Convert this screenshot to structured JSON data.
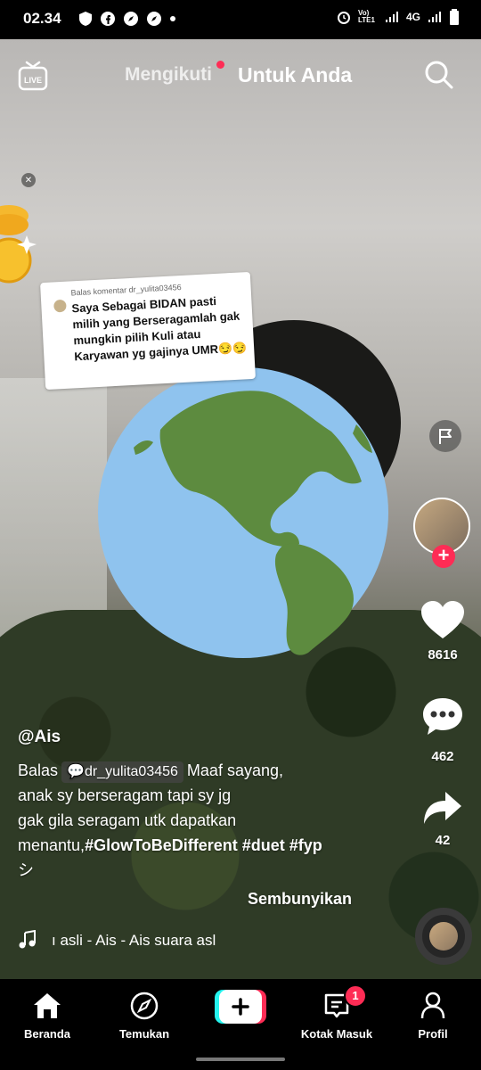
{
  "status_bar": {
    "time": "02.34",
    "network": "4G",
    "volte": "Vo) LTE1"
  },
  "top_nav": {
    "live_label": "LIVE",
    "tab_following": "Mengikuti",
    "tab_for_you": "Untuk Anda"
  },
  "reply_card": {
    "header": "Balas komentar dr_yulita03456",
    "text": "Saya Sebagai BIDAN pasti milih yang Berseragamlah gak mungkin pilih Kuli atau Karyawan yg gajinya UMR😏😏"
  },
  "actions": {
    "likes": "8616",
    "comments": "462",
    "shares": "42"
  },
  "caption": {
    "username": "@Ais",
    "reply_prefix": "Balas",
    "reply_user": "dr_yulita03456",
    "text_part1": "Maaf sayang,",
    "text_part2": "anak sy berseragam tapi sy  jg",
    "text_part3": "gak gila seragam utk dapatkan",
    "text_part4": "menantu,",
    "hashtags": "#GlowToBeDifferent #duet #fyp",
    "text_part5": "シ",
    "hide_label": "Sembunyikan"
  },
  "music": {
    "title": "ı asli - Ais - Ais     suara asl"
  },
  "bottom_nav": {
    "home": "Beranda",
    "discover": "Temukan",
    "inbox": "Kotak Masuk",
    "inbox_badge": "1",
    "profile": "Profil"
  },
  "icons": [
    "live-icon",
    "search-icon",
    "flag-icon",
    "heart-icon",
    "comment-icon",
    "share-icon",
    "music-note-icon",
    "home-icon",
    "compass-icon",
    "plus-icon",
    "inbox-icon",
    "profile-icon"
  ],
  "colors": {
    "accent": "#fe2c55",
    "bg": "#000000"
  }
}
